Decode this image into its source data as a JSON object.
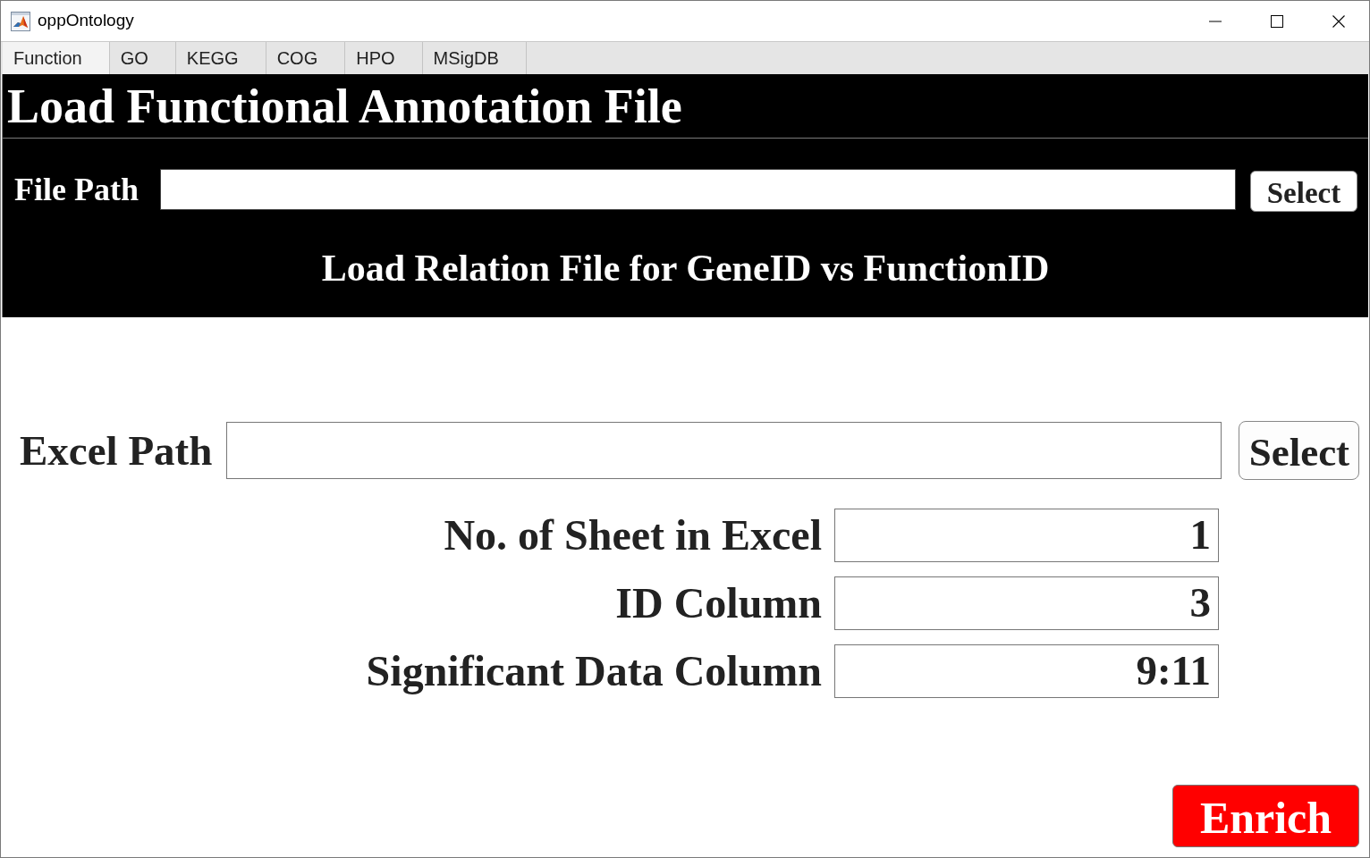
{
  "window": {
    "title": "oppOntology"
  },
  "tabs": [
    {
      "label": "Function",
      "selected": true
    },
    {
      "label": "GO",
      "selected": false
    },
    {
      "label": "KEGG",
      "selected": false
    },
    {
      "label": "COG",
      "selected": false
    },
    {
      "label": "HPO",
      "selected": false
    },
    {
      "label": "MSigDB",
      "selected": false
    }
  ],
  "header": {
    "title": "Load Functional Annotation File",
    "file_path": {
      "label": "File Path",
      "button": "Select"
    },
    "relation_heading": "Load Relation File for GeneID vs FunctionID"
  },
  "excel_path": {
    "label": "Excel Path",
    "button": "Select"
  },
  "parameters": [
    {
      "label": "No. of Sheet in Excel",
      "value": "1"
    },
    {
      "label": "ID Column",
      "value": "3"
    },
    {
      "label": "Significant Data Column",
      "value": "9:11"
    }
  ],
  "enrich_button": {
    "label": "Enrich"
  }
}
